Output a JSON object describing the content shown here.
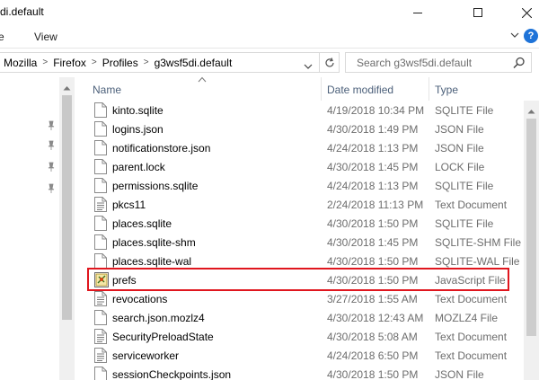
{
  "window": {
    "title": "di.default"
  },
  "ribbon": {
    "tabs": [
      {
        "label": "re"
      },
      {
        "label": "View"
      }
    ]
  },
  "address": {
    "crumbs": [
      "Mozilla",
      "Firefox",
      "Profiles",
      "g3wsf5di.default"
    ],
    "search_placeholder": "Search g3wsf5di.default"
  },
  "columns": {
    "name": "Name",
    "date": "Date modified",
    "type": "Type"
  },
  "files": [
    {
      "name": "kinto.sqlite",
      "date": "4/19/2018 10:34 PM",
      "type": "SQLITE File",
      "icon": "blank-file-icon"
    },
    {
      "name": "logins.json",
      "date": "4/30/2018 1:49 PM",
      "type": "JSON File",
      "icon": "blank-file-icon"
    },
    {
      "name": "notificationstore.json",
      "date": "4/24/2018 1:13 PM",
      "type": "JSON File",
      "icon": "blank-file-icon"
    },
    {
      "name": "parent.lock",
      "date": "4/30/2018 1:45 PM",
      "type": "LOCK File",
      "icon": "blank-file-icon"
    },
    {
      "name": "permissions.sqlite",
      "date": "4/24/2018 1:13 PM",
      "type": "SQLITE File",
      "icon": "blank-file-icon"
    },
    {
      "name": "pkcs11",
      "date": "2/24/2018 11:13 PM",
      "type": "Text Document",
      "icon": "text-file-icon"
    },
    {
      "name": "places.sqlite",
      "date": "4/30/2018 1:50 PM",
      "type": "SQLITE File",
      "icon": "blank-file-icon"
    },
    {
      "name": "places.sqlite-shm",
      "date": "4/30/2018 1:45 PM",
      "type": "SQLITE-SHM File",
      "icon": "blank-file-icon"
    },
    {
      "name": "places.sqlite-wal",
      "date": "4/30/2018 1:50 PM",
      "type": "SQLITE-WAL File",
      "icon": "blank-file-icon"
    },
    {
      "name": "prefs",
      "date": "4/30/2018 1:50 PM",
      "type": "JavaScript File",
      "icon": "javascript-file-icon"
    },
    {
      "name": "revocations",
      "date": "3/27/2018 1:55 AM",
      "type": "Text Document",
      "icon": "text-file-icon"
    },
    {
      "name": "search.json.mozlz4",
      "date": "4/30/2018 12:43 AM",
      "type": "MOZLZ4 File",
      "icon": "blank-file-icon"
    },
    {
      "name": "SecurityPreloadState",
      "date": "4/30/2018 5:08 AM",
      "type": "Text Document",
      "icon": "text-file-icon"
    },
    {
      "name": "serviceworker",
      "date": "4/24/2018 6:50 PM",
      "type": "Text Document",
      "icon": "text-file-icon"
    },
    {
      "name": "sessionCheckpoints.json",
      "date": "4/30/2018 1:50 PM",
      "type": "JSON File",
      "icon": "blank-file-icon"
    }
  ],
  "colors": {
    "highlight_border": "#e0161e",
    "header_text": "#4c607a",
    "help_blue": "#1e73d8"
  }
}
